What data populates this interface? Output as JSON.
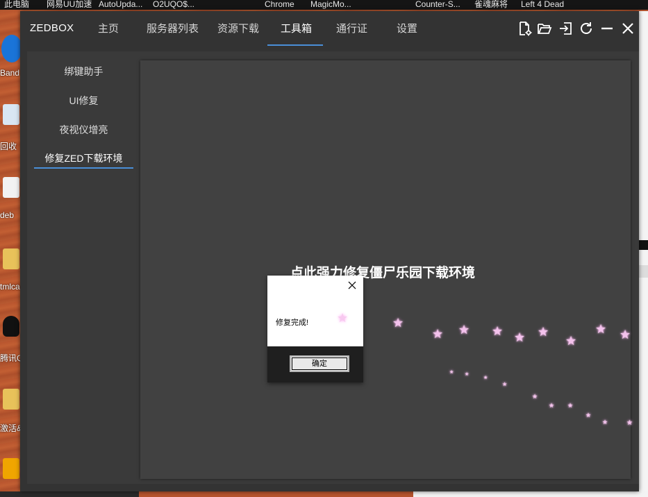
{
  "desktop": {
    "taskbar_items": [
      "此电脑",
      "网易UU加速",
      "AutoUpda...",
      "O2UQO$...",
      "Chrome",
      "MagicMo...",
      "Counter-S...",
      "雀魂麻将",
      "Left 4 Dead"
    ],
    "icon_labels": [
      "Band",
      "回收",
      "deb",
      "tmlca",
      "腾讯Q",
      "激活&"
    ]
  },
  "app": {
    "title": "ZEDBOX",
    "nav": [
      "主页",
      "服务器列表",
      "资源下载",
      "工具箱",
      "通行证",
      "设置"
    ],
    "active_nav": "工具箱",
    "window_controls": [
      "settings-file-icon",
      "folder-open-icon",
      "exit-icon",
      "refresh-icon",
      "minimize-icon",
      "close-icon"
    ],
    "accent_color": "#4a8fd9"
  },
  "toolbox": {
    "sidebar": [
      "绑键助手",
      "UI修复",
      "夜视仪增亮",
      "修复ZED下载环境"
    ],
    "active_item": "修复ZED下载环境",
    "action_title": "点此强力修复僵尸乐园下载环境"
  },
  "dialog": {
    "message": "修复完成!",
    "ok_label": "确定"
  }
}
